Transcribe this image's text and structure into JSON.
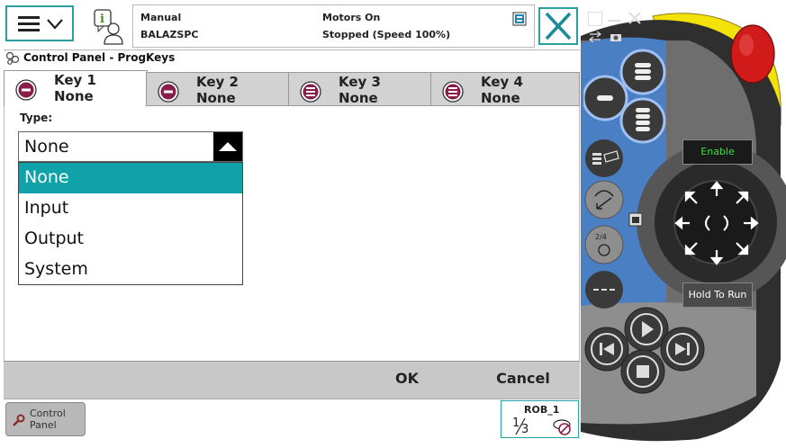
{
  "status": {
    "mode": "Manual",
    "system": "BALAZSPC",
    "motors": "Motors On",
    "state": "Stopped (Speed 100%)"
  },
  "window": {
    "title": "Control Panel - ProgKeys"
  },
  "tabs": [
    {
      "name": "Key 1",
      "value": "None"
    },
    {
      "name": "Key 2",
      "value": "None"
    },
    {
      "name": "Key 3",
      "value": "None"
    },
    {
      "name": "Key 4",
      "value": "None"
    }
  ],
  "form": {
    "type_label": "Type:",
    "type_value": "None",
    "options": [
      "None",
      "Input",
      "Output",
      "System"
    ]
  },
  "buttons": {
    "ok": "OK",
    "cancel": "Cancel"
  },
  "taskbar": {
    "item_line1": "Control",
    "item_line2": "Panel"
  },
  "robot": {
    "name": "ROB_1",
    "fraction_num": "1",
    "fraction_den": "3"
  },
  "pendant": {
    "enable": "Enable",
    "hold_to_run": "Hold To Run"
  },
  "colors": {
    "accent": "#0fa2a9",
    "frame": "#2a9fa0",
    "pendant_blue": "#4a7fc4",
    "emergency": "#d11a1a",
    "yellow": "#f2e20a"
  }
}
